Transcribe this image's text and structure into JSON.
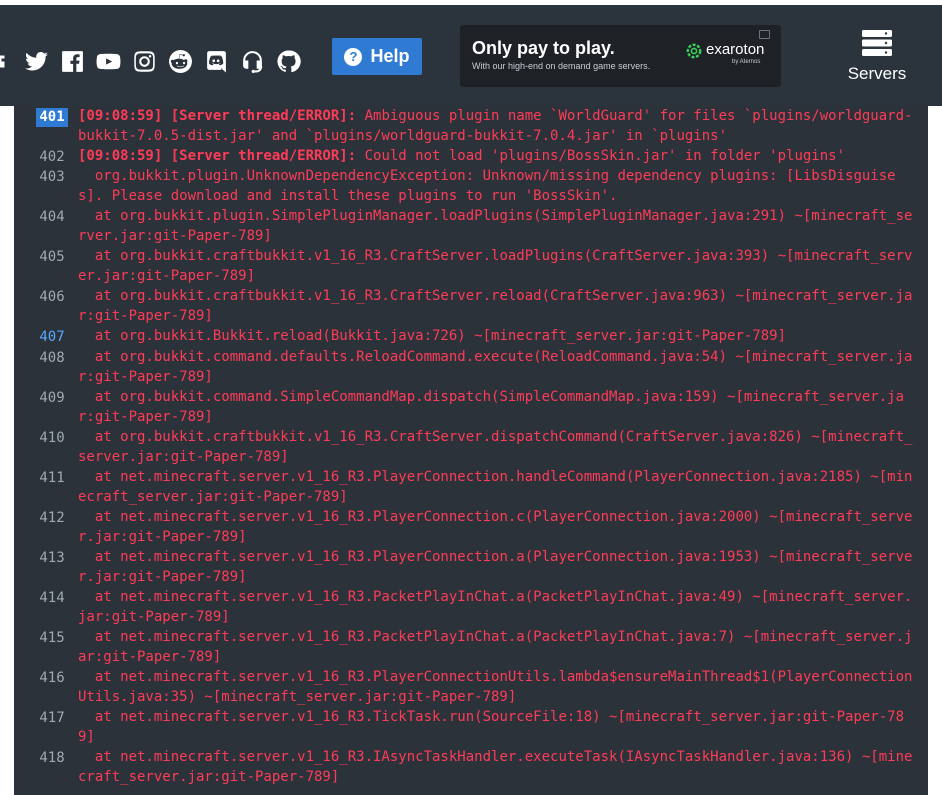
{
  "header": {
    "social_icons": [
      "partial-icon",
      "twitter-icon",
      "facebook-icon",
      "youtube-icon",
      "instagram-icon",
      "reddit-icon",
      "discord-icon",
      "headset-icon",
      "github-icon"
    ],
    "help_label": "Help",
    "ad": {
      "headline": "Only pay to play.",
      "sub": "With our high-end on demand game servers.",
      "brand": "exaroton",
      "brand_sub": "by Aternos"
    },
    "servers_label": "Servers",
    "accent_color": "#2f7bd4"
  },
  "log": {
    "error_color": "#ff3b58",
    "lines": [
      {
        "n": "401",
        "highlight": true,
        "prefix": "[09:08:59] [Server thread/ERROR]:",
        "text": " Ambiguous plugin name `WorldGuard' for files `plugins/worldguard-bukkit-7.0.5-dist.jar' and `plugins/worldguard-bukkit-7.0.4.jar' in `plugins'"
      },
      {
        "n": "402",
        "prefix": "[09:08:59] [Server thread/ERROR]:",
        "text": " Could not load 'plugins/BossSkin.jar' in folder 'plugins'"
      },
      {
        "n": "403",
        "prefix": "",
        "text": "  org.bukkit.plugin.UnknownDependencyException: Unknown/missing dependency plugins: [LibsDisguises]. Please download and install these plugins to run 'BossSkin'."
      },
      {
        "n": "404",
        "prefix": "",
        "text": "  at org.bukkit.plugin.SimplePluginManager.loadPlugins(SimplePluginManager.java:291) ~[minecraft_server.jar:git-Paper-789]"
      },
      {
        "n": "405",
        "prefix": "",
        "text": "  at org.bukkit.craftbukkit.v1_16_R3.CraftServer.loadPlugins(CraftServer.java:393) ~[minecraft_server.jar:git-Paper-789]"
      },
      {
        "n": "406",
        "prefix": "",
        "text": "  at org.bukkit.craftbukkit.v1_16_R3.CraftServer.reload(CraftServer.java:963) ~[minecraft_server.jar:git-Paper-789]"
      },
      {
        "n": "407",
        "blue": true,
        "prefix": "",
        "text": "  at org.bukkit.Bukkit.reload(Bukkit.java:726) ~[minecraft_server.jar:git-Paper-789]"
      },
      {
        "n": "408",
        "prefix": "",
        "text": "  at org.bukkit.command.defaults.ReloadCommand.execute(ReloadCommand.java:54) ~[minecraft_server.jar:git-Paper-789]"
      },
      {
        "n": "409",
        "prefix": "",
        "text": "  at org.bukkit.command.SimpleCommandMap.dispatch(SimpleCommandMap.java:159) ~[minecraft_server.jar:git-Paper-789]"
      },
      {
        "n": "410",
        "prefix": "",
        "text": "  at org.bukkit.craftbukkit.v1_16_R3.CraftServer.dispatchCommand(CraftServer.java:826) ~[minecraft_server.jar:git-Paper-789]"
      },
      {
        "n": "411",
        "prefix": "",
        "text": "  at net.minecraft.server.v1_16_R3.PlayerConnection.handleCommand(PlayerConnection.java:2185) ~[minecraft_server.jar:git-Paper-789]"
      },
      {
        "n": "412",
        "prefix": "",
        "text": "  at net.minecraft.server.v1_16_R3.PlayerConnection.c(PlayerConnection.java:2000) ~[minecraft_server.jar:git-Paper-789]"
      },
      {
        "n": "413",
        "prefix": "",
        "text": "  at net.minecraft.server.v1_16_R3.PlayerConnection.a(PlayerConnection.java:1953) ~[minecraft_server.jar:git-Paper-789]"
      },
      {
        "n": "414",
        "prefix": "",
        "text": "  at net.minecraft.server.v1_16_R3.PacketPlayInChat.a(PacketPlayInChat.java:49) ~[minecraft_server.jar:git-Paper-789]"
      },
      {
        "n": "415",
        "prefix": "",
        "text": "  at net.minecraft.server.v1_16_R3.PacketPlayInChat.a(PacketPlayInChat.java:7) ~[minecraft_server.jar:git-Paper-789]"
      },
      {
        "n": "416",
        "prefix": "",
        "text": "  at net.minecraft.server.v1_16_R3.PlayerConnectionUtils.lambda$ensureMainThread$1(PlayerConnectionUtils.java:35) ~[minecraft_server.jar:git-Paper-789]"
      },
      {
        "n": "417",
        "prefix": "",
        "text": "  at net.minecraft.server.v1_16_R3.TickTask.run(SourceFile:18) ~[minecraft_server.jar:git-Paper-789]"
      },
      {
        "n": "418",
        "prefix": "",
        "text": "  at net.minecraft.server.v1_16_R3.IAsyncTaskHandler.executeTask(IAsyncTaskHandler.java:136) ~[minecraft_server.jar:git-Paper-789]"
      }
    ]
  }
}
